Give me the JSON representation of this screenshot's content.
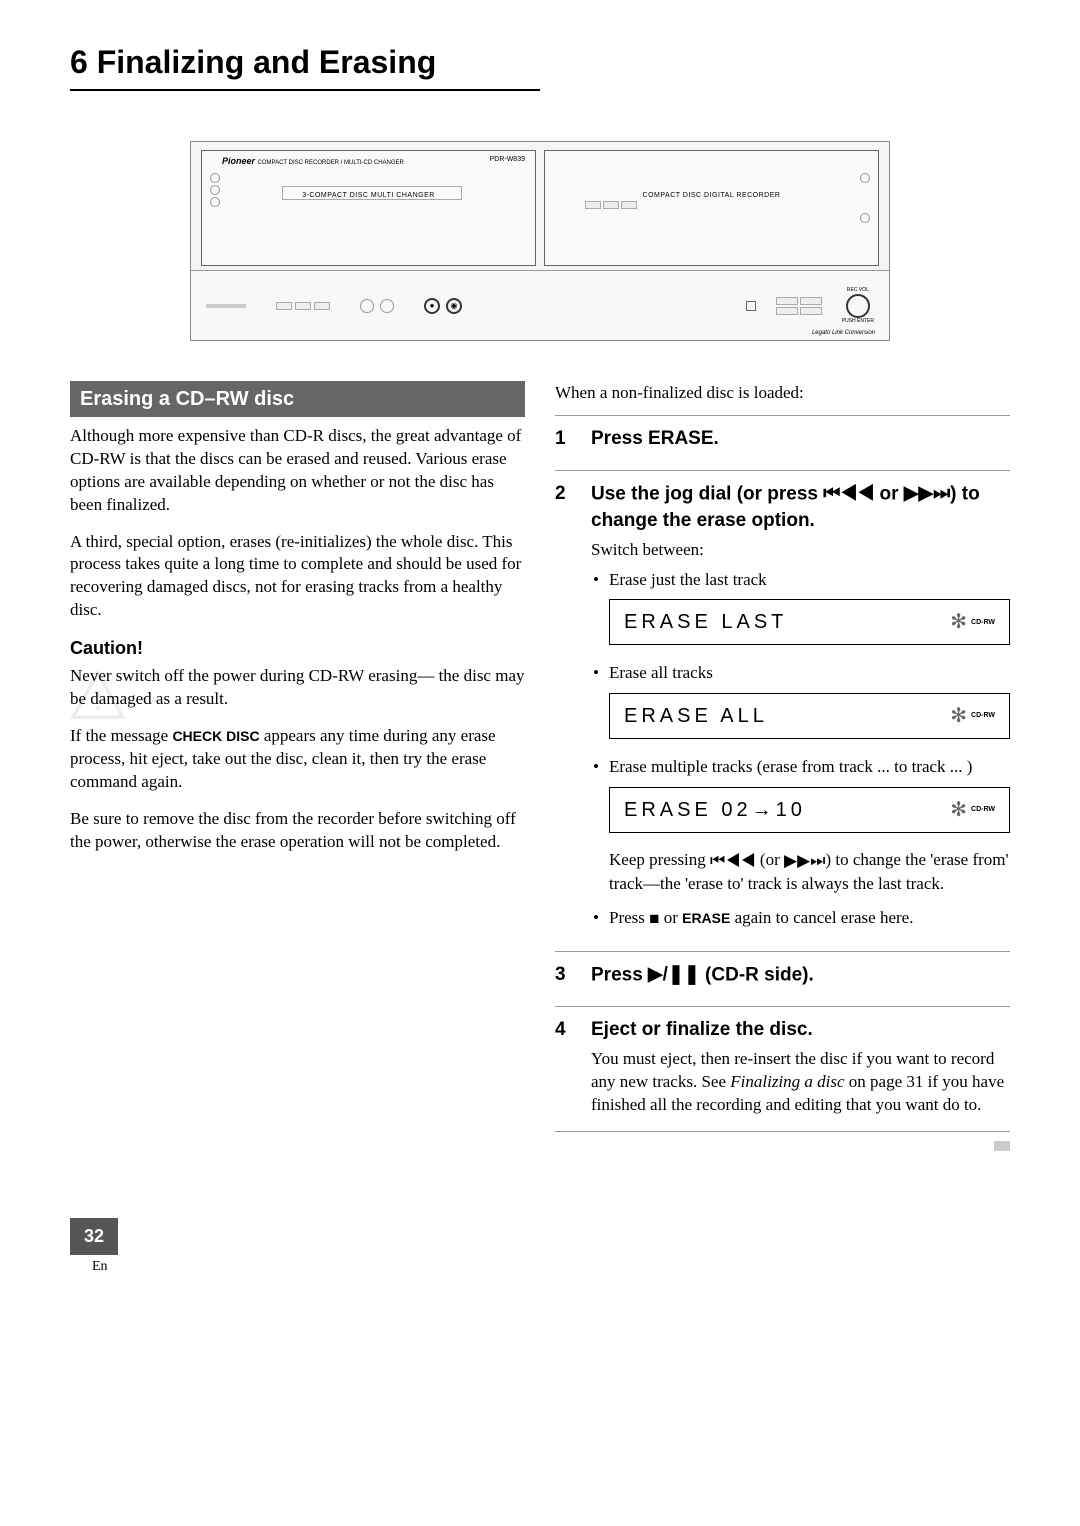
{
  "chapter": {
    "number": "6",
    "title": "Finalizing and Erasing"
  },
  "illustration": {
    "brand": "Pioneer",
    "brand_tag": "COMPACT DISC RECORDER / MULTI-CD CHANGER",
    "model": "PDR-W839",
    "left_unit_label": "3-COMPACT DISC MULTI CHANGER",
    "right_unit_label": "COMPACT DISC DIGITAL RECORDER",
    "rec_vol": "REC VOL",
    "push_enter": "PUSH ENTER",
    "legato": "Legato Link Conversion"
  },
  "section_header": "Erasing a CD–RW disc",
  "left_column": {
    "p1": "Although more expensive than CD-R discs, the great advantage of CD-RW is that the discs can be erased and reused. Various erase options are available depending on whether or not the disc has been finalized.",
    "p2": "A third, special option, erases (re-initializes) the whole disc. This process takes quite a long time to complete and should be used for recovering damaged discs, not for erasing tracks from a healthy disc.",
    "caution_label": "Caution!",
    "caution_p1": "Never switch off the power during CD-RW erasing— the disc may be damaged as a result.",
    "caution_p2_prefix": "If the message ",
    "caution_p2_bold": "CHECK DISC",
    "caution_p2_suffix": " appears any time during any erase process, hit eject, take out the disc, clean it, then try the erase command again.",
    "caution_p3": "Be sure to remove the disc from the recorder before switching off the power, otherwise the erase operation will not be completed."
  },
  "right_column": {
    "intro": "When a non-finalized disc is loaded:",
    "steps": [
      {
        "num": "1",
        "title": "Press ERASE."
      },
      {
        "num": "2",
        "title_a": "Use the jog dial (or press ",
        "title_b": " or ",
        "title_c": ") to change the erase option.",
        "body_line": "Switch between:",
        "bullets": [
          {
            "text": "Erase just the last track",
            "display": "ERASE  LAST"
          },
          {
            "text": "Erase all tracks",
            "display": "ERASE  ALL"
          },
          {
            "text": "Erase multiple tracks (erase from track ... to track ... )",
            "display": "ERASE  02→10"
          }
        ],
        "note_a": "Keep pressing ",
        "note_b": " (or ",
        "note_c": ") to change the 'erase from' track—the 'erase to' track is always the last track.",
        "cancel_a": "Press ",
        "cancel_b": " or ",
        "cancel_bold": "ERASE",
        "cancel_c": " again to cancel erase here."
      },
      {
        "num": "3",
        "title_a": "Press ",
        "title_b": " (CD-R side)."
      },
      {
        "num": "4",
        "title": "Eject or finalize the disc.",
        "body_a": "You must eject, then re-insert the disc if you want to record any new tracks. See ",
        "body_italic": "Finalizing a disc",
        "body_b": " on page 31 if you have finished all the recording and editing that you want do to."
      }
    ],
    "cdrw_badge": "CD-RW"
  },
  "footer": {
    "page_number": "32",
    "lang": "En"
  }
}
